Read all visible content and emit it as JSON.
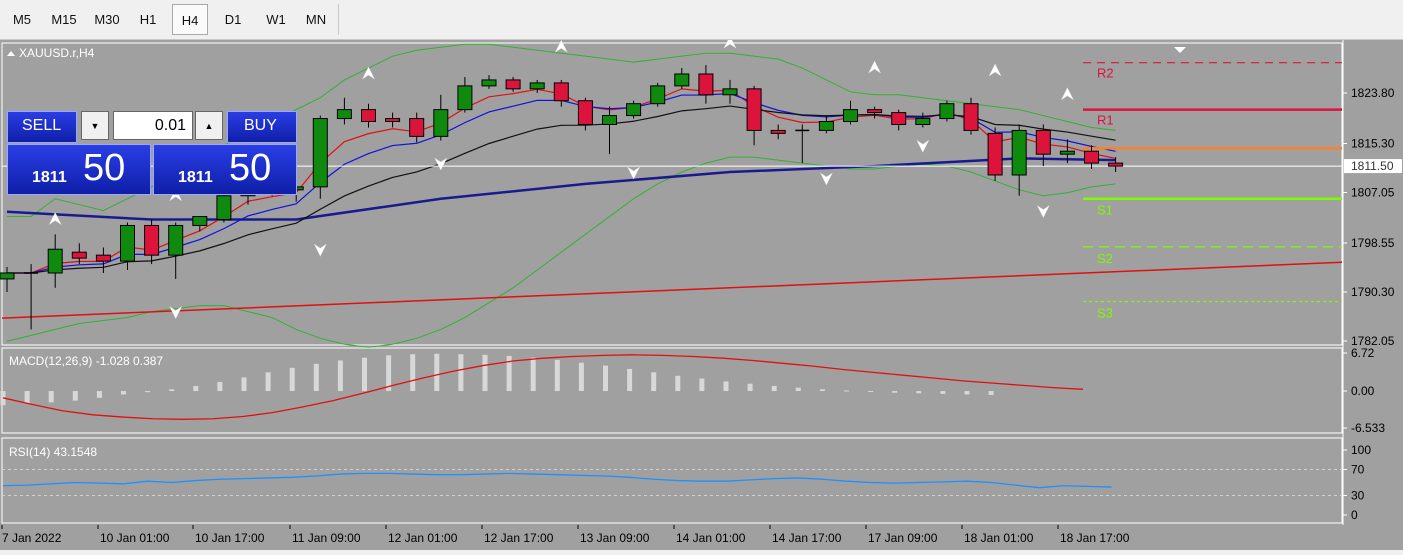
{
  "timeframes": [
    "M5",
    "M15",
    "M30",
    "H1",
    "H4",
    "D1",
    "W1",
    "MN"
  ],
  "active_timeframe": "H4",
  "chart": {
    "symbol_label": "XAUUSD.r,H4",
    "price_ticks": [
      "1823.80",
      "1815.30",
      "1807.05",
      "1798.55",
      "1790.30",
      "1782.05"
    ],
    "current_price_label": "1811.50",
    "pivot_labels": [
      "R2",
      "R1",
      "S1",
      "S2",
      "S3"
    ],
    "time_labels": [
      "7 Jan 2022",
      "10 Jan 01:00",
      "10 Jan 17:00",
      "11 Jan 09:00",
      "12 Jan 01:00",
      "12 Jan 17:00",
      "13 Jan 09:00",
      "14 Jan 01:00",
      "14 Jan 17:00",
      "17 Jan 09:00",
      "18 Jan 01:00",
      "18 Jan 17:00"
    ],
    "colors": {
      "background": "#a0a0a0",
      "bull": "#0f8a0f",
      "bear": "#dc143c",
      "pivot_r": "#dc143c",
      "pivot_s": "#7cfc00",
      "pivot_mid": "#ff7f27",
      "ma_long": "#e01010",
      "ma_mid": "#1a1a90"
    }
  },
  "trade_panel": {
    "sell_label": "SELL",
    "buy_label": "BUY",
    "lot_value": "0.01",
    "sell_price_small": "1811",
    "sell_price_big": "50",
    "buy_price_small": "1811",
    "buy_price_big": "50"
  },
  "macd": {
    "label": "MACD(12,26,9) -1.028 0.387",
    "ticks": [
      "6.72",
      "0.00",
      "-6.533"
    ]
  },
  "rsi": {
    "label": "RSI(14) 43.1548",
    "ticks": [
      "100",
      "70",
      "30",
      "0"
    ]
  },
  "chart_data": {
    "type": "candlestick",
    "ohlc": [
      {
        "o": 1792.5,
        "h": 1794.5,
        "l": 1790.3,
        "c": 1793.5
      },
      {
        "o": 1793.5,
        "h": 1795.0,
        "l": 1784.0,
        "c": 1793.5
      },
      {
        "o": 1793.5,
        "h": 1800.0,
        "l": 1791.0,
        "c": 1797.5
      },
      {
        "o": 1797.0,
        "h": 1798.5,
        "l": 1795.0,
        "c": 1796.0
      },
      {
        "o": 1796.5,
        "h": 1797.8,
        "l": 1793.5,
        "c": 1795.5
      },
      {
        "o": 1795.5,
        "h": 1802.0,
        "l": 1794.0,
        "c": 1801.5
      },
      {
        "o": 1801.5,
        "h": 1802.5,
        "l": 1795.0,
        "c": 1796.5
      },
      {
        "o": 1796.5,
        "h": 1802.0,
        "l": 1792.5,
        "c": 1801.5
      },
      {
        "o": 1801.5,
        "h": 1803.0,
        "l": 1800.5,
        "c": 1803.0
      },
      {
        "o": 1802.5,
        "h": 1808.5,
        "l": 1802.0,
        "c": 1806.5
      },
      {
        "o": 1806.5,
        "h": 1810.0,
        "l": 1805.0,
        "c": 1809.5
      },
      {
        "o": 1809.5,
        "h": 1811.0,
        "l": 1806.5,
        "c": 1807.5
      },
      {
        "o": 1807.5,
        "h": 1810.5,
        "l": 1805.5,
        "c": 1808.0
      },
      {
        "o": 1808.0,
        "h": 1820.0,
        "l": 1806.0,
        "c": 1819.5
      },
      {
        "o": 1819.5,
        "h": 1823.0,
        "l": 1818.5,
        "c": 1821.0
      },
      {
        "o": 1821.0,
        "h": 1822.0,
        "l": 1818.0,
        "c": 1819.0
      },
      {
        "o": 1819.5,
        "h": 1820.5,
        "l": 1818.0,
        "c": 1819.0
      },
      {
        "o": 1819.5,
        "h": 1820.5,
        "l": 1815.5,
        "c": 1816.5
      },
      {
        "o": 1816.5,
        "h": 1823.5,
        "l": 1815.8,
        "c": 1821.0
      },
      {
        "o": 1821.0,
        "h": 1826.5,
        "l": 1820.5,
        "c": 1825.0
      },
      {
        "o": 1825.0,
        "h": 1826.8,
        "l": 1824.5,
        "c": 1826.0
      },
      {
        "o": 1826.0,
        "h": 1826.5,
        "l": 1824.0,
        "c": 1824.5
      },
      {
        "o": 1824.5,
        "h": 1826.0,
        "l": 1823.8,
        "c": 1825.5
      },
      {
        "o": 1825.5,
        "h": 1826.0,
        "l": 1821.5,
        "c": 1822.5
      },
      {
        "o": 1822.5,
        "h": 1823.0,
        "l": 1817.5,
        "c": 1818.5
      },
      {
        "o": 1818.5,
        "h": 1821.5,
        "l": 1813.5,
        "c": 1820.0
      },
      {
        "o": 1820.0,
        "h": 1822.5,
        "l": 1819.5,
        "c": 1822.0
      },
      {
        "o": 1822.0,
        "h": 1825.5,
        "l": 1821.5,
        "c": 1825.0
      },
      {
        "o": 1825.0,
        "h": 1828.0,
        "l": 1824.5,
        "c": 1827.0
      },
      {
        "o": 1827.0,
        "h": 1828.5,
        "l": 1822.0,
        "c": 1823.5
      },
      {
        "o": 1823.5,
        "h": 1826.0,
        "l": 1822.0,
        "c": 1824.5
      },
      {
        "o": 1824.5,
        "h": 1825.0,
        "l": 1815.0,
        "c": 1817.5
      },
      {
        "o": 1817.5,
        "h": 1818.5,
        "l": 1816.0,
        "c": 1817.0
      },
      {
        "o": 1817.5,
        "h": 1818.5,
        "l": 1812.0,
        "c": 1817.5
      },
      {
        "o": 1817.5,
        "h": 1820.0,
        "l": 1817.0,
        "c": 1819.0
      },
      {
        "o": 1819.0,
        "h": 1822.5,
        "l": 1818.5,
        "c": 1821.0
      },
      {
        "o": 1821.0,
        "h": 1821.5,
        "l": 1819.5,
        "c": 1820.5
      },
      {
        "o": 1820.5,
        "h": 1821.0,
        "l": 1817.5,
        "c": 1818.5
      },
      {
        "o": 1818.5,
        "h": 1820.5,
        "l": 1818.0,
        "c": 1819.5
      },
      {
        "o": 1819.5,
        "h": 1822.5,
        "l": 1819.0,
        "c": 1822.0
      },
      {
        "o": 1822.0,
        "h": 1823.0,
        "l": 1816.8,
        "c": 1817.5
      },
      {
        "o": 1817.0,
        "h": 1818.0,
        "l": 1809.0,
        "c": 1810.0
      },
      {
        "o": 1810.0,
        "h": 1818.5,
        "l": 1806.5,
        "c": 1817.5
      },
      {
        "o": 1817.5,
        "h": 1818.5,
        "l": 1811.5,
        "c": 1813.5
      },
      {
        "o": 1813.5,
        "h": 1816.0,
        "l": 1812.0,
        "c": 1814.0
      },
      {
        "o": 1814.0,
        "h": 1815.0,
        "l": 1811.0,
        "c": 1812.0
      },
      {
        "o": 1812.0,
        "h": 1813.0,
        "l": 1810.5,
        "c": 1811.5
      }
    ],
    "pivots": {
      "R2": 1828.9,
      "R1": 1821.0,
      "PP": 1814.5,
      "S1": 1806.0,
      "S2": 1797.9,
      "S3": 1788.7
    },
    "ma_long": [
      1785.9,
      1795.3
    ],
    "ma_mid": [
      [
        0,
        1803.8
      ],
      [
        6,
        1802.5
      ],
      [
        12,
        1802.5
      ],
      [
        18,
        1806.0
      ],
      [
        24,
        1808.5
      ],
      [
        30,
        1810.5
      ],
      [
        36,
        1811.5
      ],
      [
        42,
        1812.8
      ],
      [
        46,
        1812.5
      ]
    ],
    "macd_hist": [
      -2.5,
      -2.2,
      -2.0,
      -1.7,
      -1.2,
      -0.6,
      -0.2,
      0.3,
      0.9,
      1.6,
      2.4,
      3.3,
      4.1,
      4.8,
      5.4,
      5.9,
      6.3,
      6.5,
      6.6,
      6.5,
      6.4,
      6.2,
      5.9,
      5.5,
      5.0,
      4.5,
      3.9,
      3.3,
      2.7,
      2.2,
      1.7,
      1.3,
      0.9,
      0.6,
      0.3,
      0.1,
      -0.1,
      -0.3,
      -0.4,
      -0.5,
      -0.6,
      -0.7
    ],
    "macd_signal": [
      -1.2,
      -2.4,
      -3.5,
      -4.2,
      -4.6,
      -4.9,
      -5.0,
      -4.9,
      -4.5,
      -3.8,
      -2.8,
      -1.7,
      -0.4,
      1.0,
      2.3,
      3.5,
      4.5,
      5.3,
      5.8,
      6.1,
      6.3,
      6.4,
      6.3,
      6.1,
      5.8,
      5.4,
      4.9,
      4.4,
      3.8,
      3.3,
      2.8,
      2.3,
      1.8,
      1.4,
      1.0,
      0.6,
      0.3
    ],
    "rsi": [
      45,
      46,
      48,
      50,
      49,
      48,
      52,
      50,
      53,
      55,
      56,
      57,
      58,
      60,
      63,
      64,
      64,
      63,
      62,
      62,
      63,
      64,
      63,
      62,
      61,
      60,
      58,
      55,
      53,
      52,
      52,
      54,
      56,
      57,
      55,
      52,
      50,
      49,
      50,
      51,
      52,
      50,
      46,
      42,
      45,
      44,
      43
    ],
    "macd_range": [
      -6.533,
      6.72
    ],
    "rsi_levels": [
      70,
      30
    ]
  }
}
